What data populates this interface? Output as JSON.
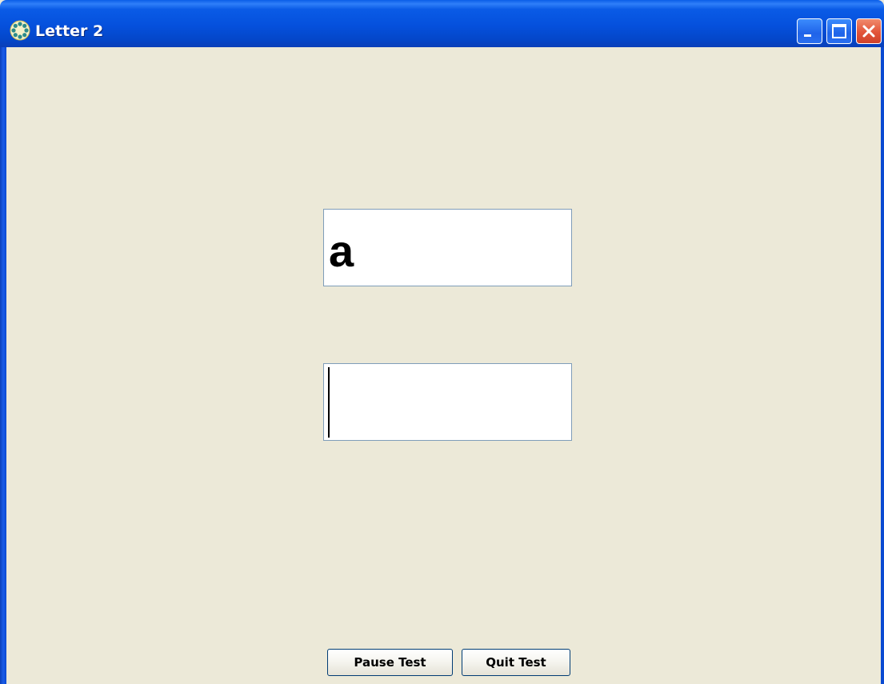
{
  "window": {
    "title": "Letter 2",
    "icon": "settings-gear-icon"
  },
  "title_buttons": {
    "minimize": "minimize-icon",
    "maximize": "maximize-icon",
    "close": "close-icon"
  },
  "display": {
    "letter": "a"
  },
  "input": {
    "value": ""
  },
  "buttons": {
    "pause_label": "Pause Test",
    "quit_label": "Quit Test"
  },
  "colors": {
    "title_bar": "#0550dc",
    "window_background": "#ece9d8",
    "close_button": "#e2543a",
    "field_border": "#7f9db9"
  }
}
